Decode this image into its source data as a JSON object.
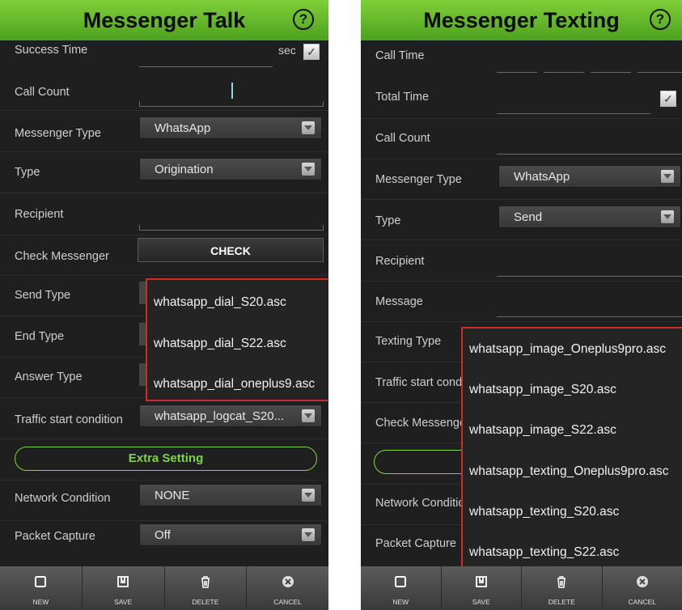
{
  "left": {
    "title": "Messenger Talk",
    "help_icon": "question-circle-icon",
    "rows": {
      "success_time": {
        "label": "Success Time",
        "unit": "sec"
      },
      "call_count": {
        "label": "Call Count"
      },
      "messenger_type": {
        "label": "Messenger Type",
        "value": "WhatsApp"
      },
      "type": {
        "label": "Type",
        "value": "Origination"
      },
      "recipient": {
        "label": "Recipient"
      },
      "check_messenger": {
        "label": "Check Messenger",
        "button": "CHECK"
      },
      "send_type": {
        "label": "Send Type"
      },
      "end_type": {
        "label": "End Type"
      },
      "answer_type": {
        "label": "Answer Type"
      },
      "traffic_start": {
        "label": "Traffic start condition",
        "value": "whatsapp_logcat_S20..."
      },
      "extra_setting": {
        "label": "Extra Setting"
      },
      "network_condition": {
        "label": "Network Condition",
        "value": "NONE"
      },
      "packet_capture": {
        "label": "Packet Capture",
        "value": "Off"
      }
    },
    "dropdown_options": [
      "whatsapp_dial_S20.asc",
      "whatsapp_dial_S22.asc",
      "whatsapp_dial_oneplus9.asc"
    ]
  },
  "right": {
    "title": "Messenger Texting",
    "help_icon": "question-circle-icon",
    "rows": {
      "call_time": {
        "label": "Call Time"
      },
      "total_time": {
        "label": "Total Time"
      },
      "call_count": {
        "label": "Call Count"
      },
      "messenger_type": {
        "label": "Messenger Type",
        "value": "WhatsApp"
      },
      "type": {
        "label": "Type",
        "value": "Send"
      },
      "recipient": {
        "label": "Recipient"
      },
      "message": {
        "label": "Message"
      },
      "texting_type": {
        "label": "Texting Type"
      },
      "traffic_start": {
        "label": "Traffic start cond"
      },
      "check_messenger": {
        "label": "Check Messenge"
      },
      "network_condition": {
        "label": "Network Conditic"
      },
      "packet_capture": {
        "label": "Packet Capture"
      }
    },
    "dropdown_options": [
      "whatsapp_image_Oneplus9pro.asc",
      "whatsapp_image_S20.asc",
      "whatsapp_image_S22.asc",
      "whatsapp_texting_Oneplus9pro.asc",
      "whatsapp_texting_S20.asc",
      "whatsapp_texting_S22.asc"
    ]
  },
  "bottom_bar": [
    {
      "label": "NEW",
      "icon": "square-icon"
    },
    {
      "label": "SAVE",
      "icon": "save-icon"
    },
    {
      "label": "DELETE",
      "icon": "trash-icon"
    },
    {
      "label": "CANCEL",
      "icon": "cancel-circle-icon"
    }
  ],
  "colors": {
    "header_green": "#5cb82a",
    "accent_green": "#7dd642",
    "highlight_red": "#d12a2a",
    "background": "#1f1f1f"
  }
}
